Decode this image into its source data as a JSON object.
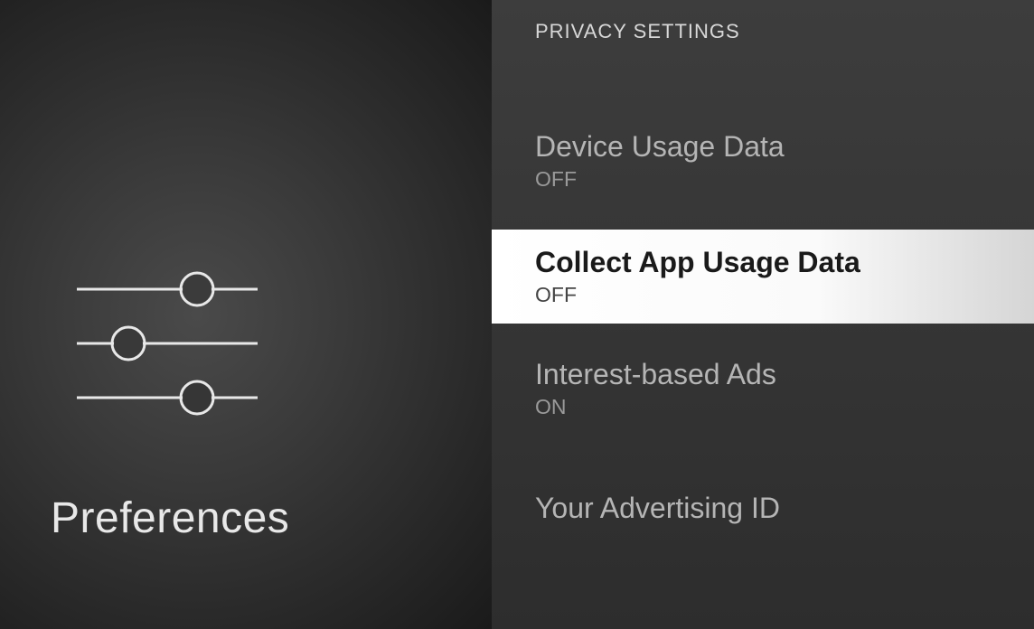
{
  "left": {
    "title": "Preferences"
  },
  "section": {
    "header": "PRIVACY SETTINGS"
  },
  "items": [
    {
      "label": "Device Usage Data",
      "value": "OFF",
      "selected": false
    },
    {
      "label": "Collect App Usage Data",
      "value": "OFF",
      "selected": true
    },
    {
      "label": "Interest-based Ads",
      "value": "ON",
      "selected": false
    },
    {
      "label": "Your Advertising ID",
      "value": "",
      "selected": false
    }
  ]
}
